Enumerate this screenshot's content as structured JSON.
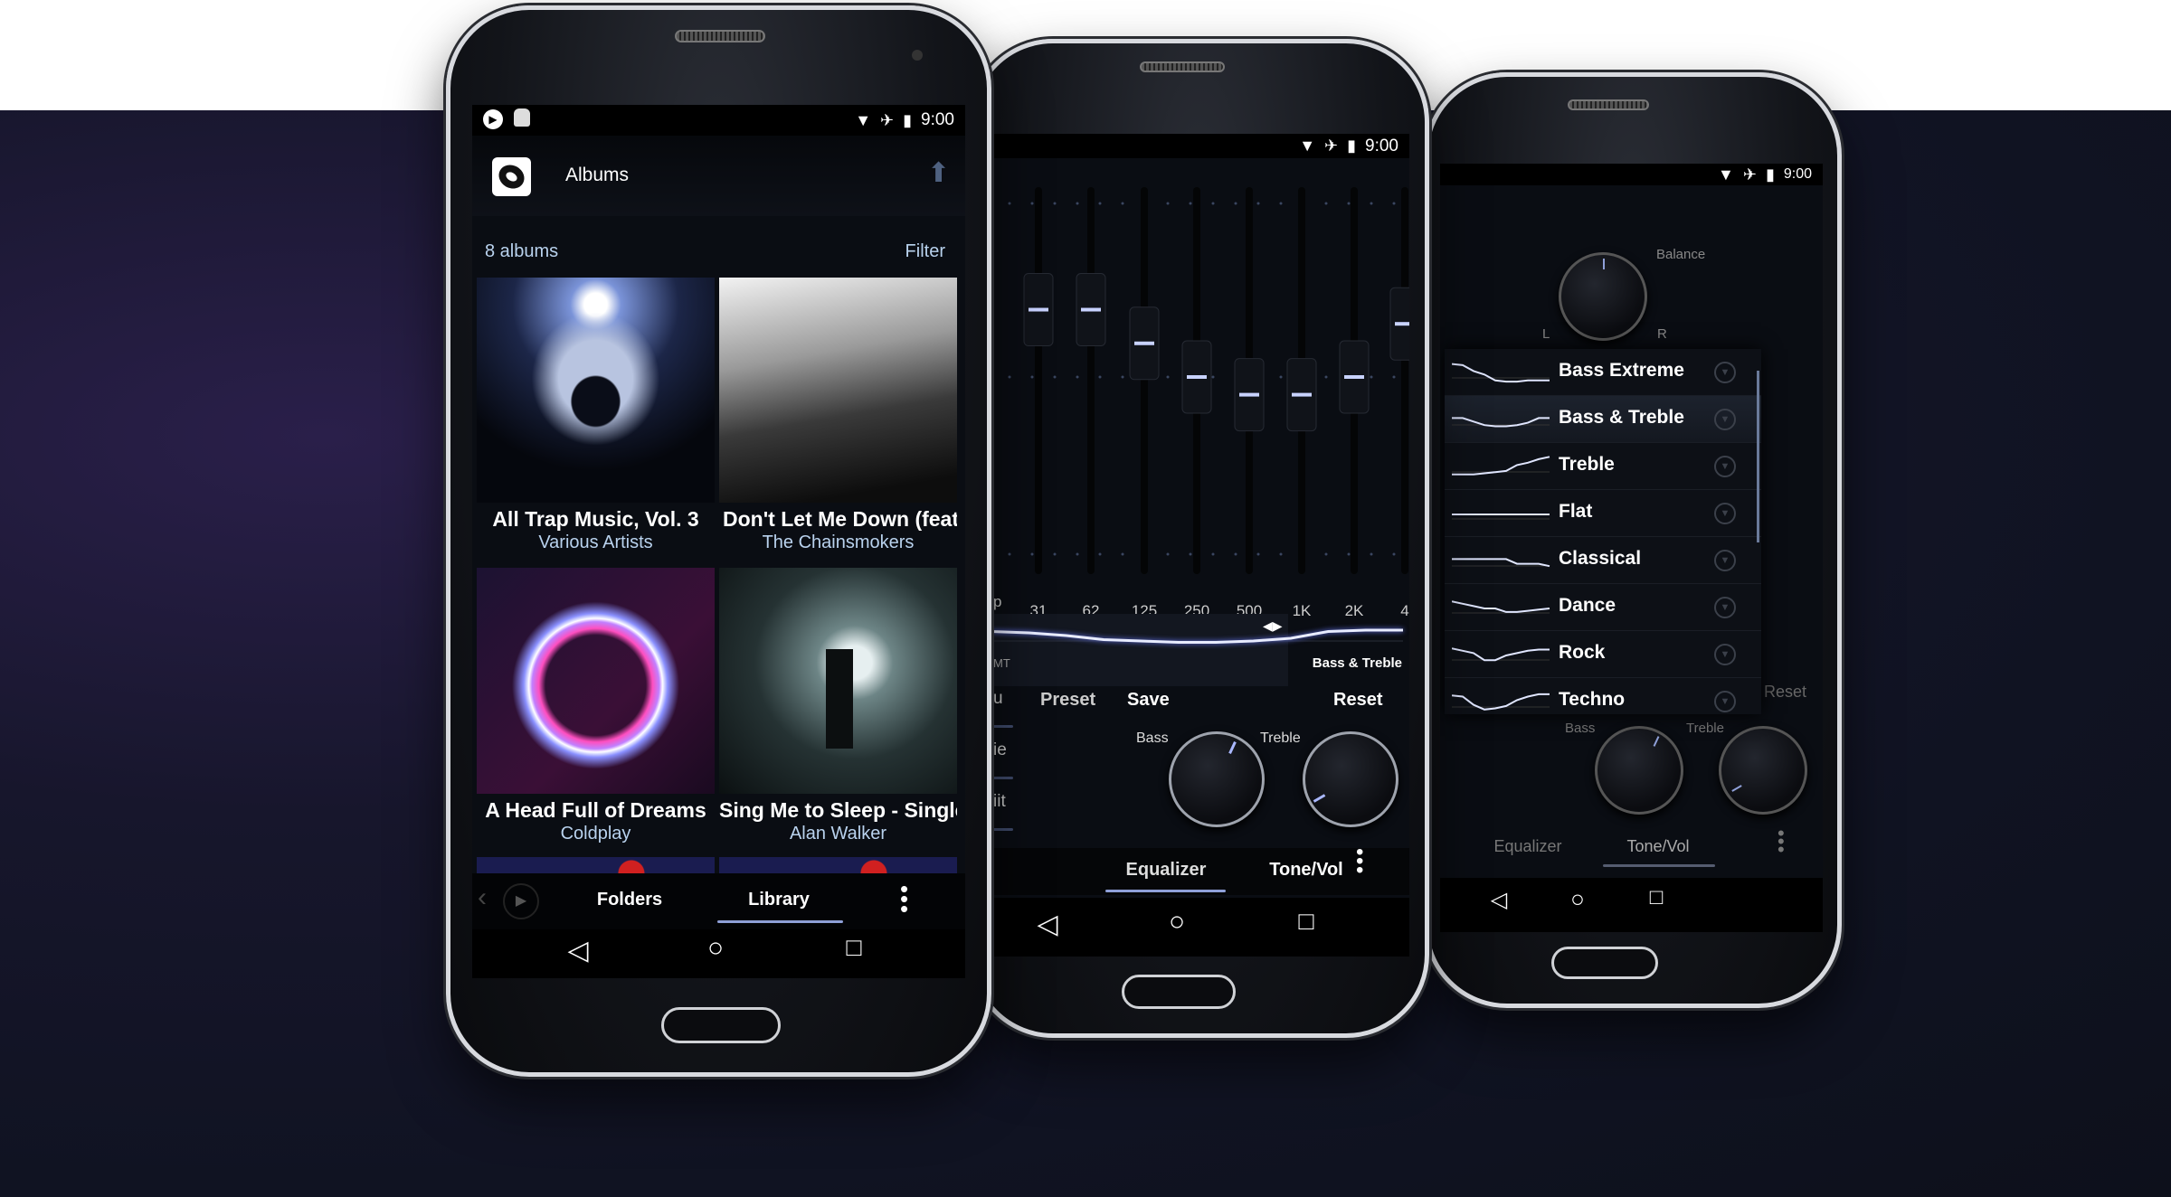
{
  "colors": {
    "accent": "#8fa0d8",
    "background": "#12142a",
    "artist_text": "#b9d2ee"
  },
  "status_bar": {
    "time": "9:00",
    "left_icons": [
      "play-circle-icon",
      "android-icon"
    ],
    "right_icons": [
      "wifi-icon",
      "airplane-icon",
      "battery-charging-icon"
    ]
  },
  "library": {
    "title": "Albums",
    "count_label": "8 albums",
    "filter_label": "Filter",
    "albums": [
      {
        "title": "All Trap Music, Vol. 3",
        "artist": "Various Artists"
      },
      {
        "title": "Don't Let Me Down (feat.",
        "artist": "The Chainsmokers"
      },
      {
        "title": "A Head Full of Dreams",
        "artist": "Coldplay"
      },
      {
        "title": "Sing Me to Sleep - Single",
        "artist": "Alan Walker"
      }
    ],
    "tabs": [
      {
        "label": "Folders",
        "active": false
      },
      {
        "label": "Library",
        "active": true
      }
    ]
  },
  "equalizer": {
    "bands": [
      {
        "label": "31",
        "level": 0.38
      },
      {
        "label": "62",
        "level": 0.38
      },
      {
        "label": "125",
        "level": 0.19
      },
      {
        "label": "250",
        "level": 0
      },
      {
        "label": "500",
        "level": -0.1
      },
      {
        "label": "1K",
        "level": -0.1
      },
      {
        "label": "2K",
        "level": 0
      },
      {
        "label": "4",
        "level": 0.3
      }
    ],
    "band_prefix": "p",
    "curve": [
      0.35,
      0.3,
      0.2,
      0.05,
      0,
      -0.05,
      -0.05,
      0,
      0.1,
      0.35,
      0.4,
      0.4
    ],
    "preset_name": "Bass & Treble",
    "fragments": {
      "side1": "MT",
      "side2": "u",
      "side3": "ie",
      "side4": "iit"
    },
    "buttons": {
      "preset": "Preset",
      "save": "Save",
      "reset": "Reset"
    },
    "knobs": {
      "bass": {
        "label": "Bass",
        "value": 0.6
      },
      "treble": {
        "label": "Treble",
        "value": -0.7
      }
    },
    "tabs": [
      {
        "label": "Equalizer",
        "active": true
      },
      {
        "label": "Tone/Vol",
        "active": false
      }
    ]
  },
  "tone": {
    "balance": {
      "label": "Balance",
      "left": "L",
      "right": "R",
      "value": 0
    },
    "presets": [
      {
        "name": "Bass Extreme",
        "curve": [
          0.9,
          0.85,
          0.6,
          0.45,
          0.2,
          0.15,
          0.15,
          0.2,
          0.2,
          0.2
        ],
        "selected": false
      },
      {
        "name": "Bass & Treble",
        "curve": [
          0.6,
          0.6,
          0.45,
          0.3,
          0.25,
          0.25,
          0.3,
          0.4,
          0.6,
          0.6
        ],
        "selected": true
      },
      {
        "name": "Treble",
        "curve": [
          0.2,
          0.2,
          0.2,
          0.25,
          0.3,
          0.35,
          0.6,
          0.7,
          0.85,
          0.95
        ],
        "selected": false
      },
      {
        "name": "Flat",
        "curve": [
          0.5,
          0.5,
          0.5,
          0.5,
          0.5,
          0.5,
          0.5,
          0.5,
          0.5,
          0.5
        ],
        "selected": false
      },
      {
        "name": "Classical",
        "curve": [
          0.6,
          0.6,
          0.6,
          0.6,
          0.6,
          0.6,
          0.4,
          0.4,
          0.4,
          0.3
        ],
        "selected": false
      },
      {
        "name": "Dance",
        "curve": [
          0.8,
          0.7,
          0.6,
          0.5,
          0.5,
          0.35,
          0.35,
          0.4,
          0.45,
          0.5
        ],
        "selected": false
      },
      {
        "name": "Rock",
        "curve": [
          0.8,
          0.7,
          0.6,
          0.3,
          0.3,
          0.5,
          0.6,
          0.7,
          0.75,
          0.75
        ],
        "selected": false
      },
      {
        "name": "Techno",
        "curve": [
          0.8,
          0.75,
          0.4,
          0.2,
          0.25,
          0.35,
          0.6,
          0.75,
          0.85,
          0.85
        ],
        "selected": false
      }
    ],
    "reset": "Reset",
    "knobs": {
      "bass": {
        "label": "Bass",
        "value": 0.6
      },
      "treble": {
        "label": "Treble",
        "value": -0.7
      }
    },
    "tabs": [
      {
        "label": "Equalizer",
        "active": false
      },
      {
        "label": "Tone/Vol",
        "active": true
      }
    ]
  }
}
